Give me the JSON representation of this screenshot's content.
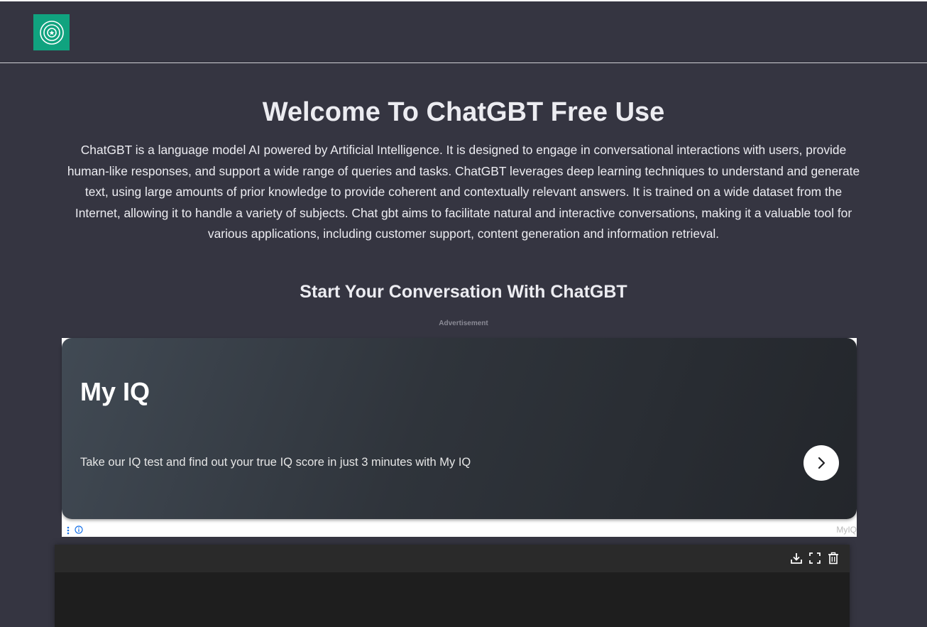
{
  "header": {
    "logo_icon": "chatgbt-logo-icon",
    "brand_color": "#10a37f"
  },
  "main": {
    "title": "Welcome To ChatGBT Free Use",
    "intro": "ChatGBT is a language model AI powered by Artificial Intelligence. It is designed to engage in conversational interactions with users, provide human-like responses, and support a wide range of queries and tasks. ChatGBT leverages deep learning techniques to understand and generate text, using large amounts of prior knowledge to provide coherent and contextually relevant answers. It is trained on a wide dataset from the Internet, allowing it to handle a variety of subjects. Chat gbt aims to facilitate natural and interactive conversations, making it a valuable tool for various applications, including customer support, content generation and information retrieval.",
    "subtitle": "Start Your Conversation With ChatGBT"
  },
  "ad": {
    "label": "Advertisement",
    "heading": "My IQ",
    "text": "Take our IQ test and find out your true IQ score in just 3 minutes with My IQ",
    "brand": "MyIQ",
    "cta_icon": "chevron-right-icon",
    "choices_icon": "vertical-dots-icon",
    "info_icon": "info-icon"
  },
  "chat_panel": {
    "toolbar": [
      "download-icon",
      "fullscreen-icon",
      "trash-icon"
    ],
    "background": "#1e1e1e"
  }
}
